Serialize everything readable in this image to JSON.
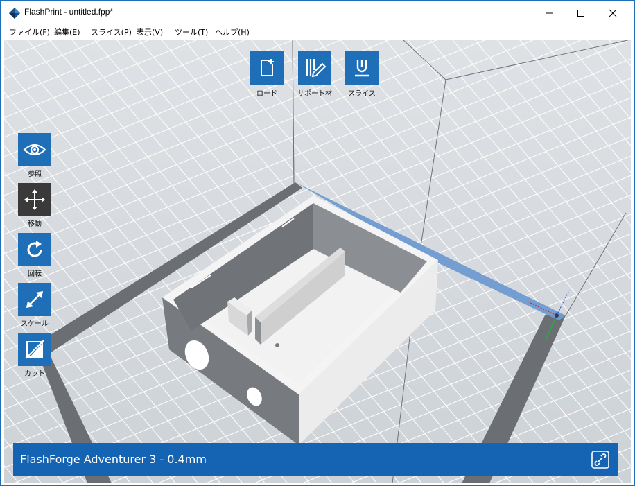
{
  "window": {
    "title": "FlashPrint - untitled.fpp*",
    "controls": [
      "minimize",
      "maximize",
      "close"
    ]
  },
  "menubar": {
    "items": [
      "ファイル(F)",
      "編集(E)",
      "スライス(P)",
      "表示(V)",
      "ツール(T)",
      "ヘルプ(H)"
    ]
  },
  "toolbar_top": {
    "items": [
      {
        "label": "ロード",
        "icon": "load-file-icon"
      },
      {
        "label": "サポート材",
        "icon": "support-material-icon"
      },
      {
        "label": "スライス",
        "icon": "slice-icon"
      }
    ]
  },
  "toolbar_left": {
    "items": [
      {
        "label": "参照",
        "icon": "eye-icon",
        "active": false
      },
      {
        "label": "移動",
        "icon": "move-arrows-icon",
        "active": true
      },
      {
        "label": "回転",
        "icon": "rotate-icon",
        "active": false
      },
      {
        "label": "スケール",
        "icon": "scale-icon",
        "active": false
      },
      {
        "label": "カット",
        "icon": "cut-icon",
        "active": false
      }
    ]
  },
  "status": {
    "printer": "FlashForge Adventurer 3 - 0.4mm",
    "icon": "link-icon"
  },
  "colors": {
    "accent": "#1f6fb8",
    "status_bar": "#1564b4",
    "active_tool": "#3a3a3a",
    "floor": "#c7ccd2"
  }
}
